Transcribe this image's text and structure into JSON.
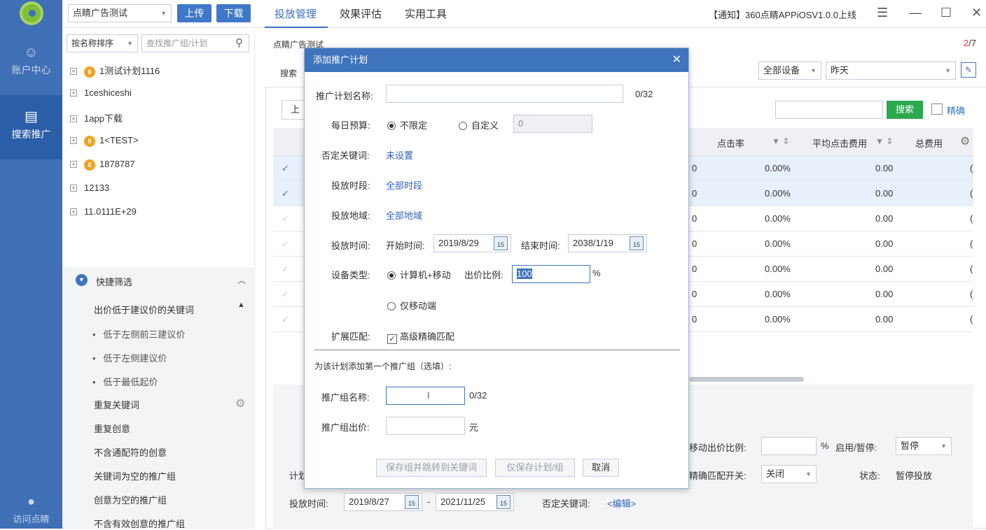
{
  "nav": {
    "items": [
      {
        "label": "账户中心",
        "icon": "account-icon"
      },
      {
        "label": "搜索推广",
        "icon": "search-promo-icon"
      }
    ],
    "bottom_label": "访问点睛"
  },
  "topbar": {
    "account_select": "点睛广告测试",
    "upload_label": "上传",
    "download_label": "下载",
    "tabs": [
      "投放管理",
      "效果评估",
      "实用工具"
    ],
    "notice": "【通知】360点睛APPiOSV1.0.0上线",
    "menu_icon": "menu-icon",
    "minimize_icon": "minimize-icon",
    "maximize_icon": "maximize-icon",
    "close_icon": "close-icon"
  },
  "sidebar": {
    "sort_select": "按名称排序",
    "search_placeholder": "查找推广组/计划",
    "plans": [
      {
        "name": "1测试计划1116",
        "paused": true
      },
      {
        "name": "1ceshiceshi",
        "paused": false
      },
      {
        "name": "1app下载",
        "paused": false
      },
      {
        "name": "1<TEST>",
        "paused": true
      },
      {
        "name": "1878787",
        "paused": true
      },
      {
        "name": "12133",
        "paused": false
      },
      {
        "name": "11.0111E+29",
        "paused": false
      }
    ],
    "quick_filter": {
      "title": "快捷筛选",
      "group": "出价低于建议价的关键词",
      "sub": [
        "低于左侧前三建议价",
        "低于左侧建议价",
        "低于最低起价"
      ],
      "items": [
        "重复关键词",
        "重复创意",
        "不含通配符的创意",
        "关键词为空的推广组",
        "创意为空的推广组",
        "不含有效创意的推广组"
      ]
    }
  },
  "main": {
    "breadcrumb": "点睛广告测试",
    "page": "2",
    "total": "/7",
    "search_label_partial": "搜索",
    "device_select": "全部设备",
    "date_select": "昨天",
    "upload_partial": "上",
    "search_button": "搜索",
    "exact_label": "精确",
    "columns": [
      "点击率",
      "平均点击费用",
      "总费用"
    ],
    "rows": [
      {
        "checked": true,
        "prev": "0",
        "ctr": "0.00%",
        "cpc": "0.00",
        "cost": "("
      },
      {
        "checked": true,
        "prev": "0",
        "ctr": "0.00%",
        "cpc": "0.00",
        "cost": "("
      },
      {
        "checked": false,
        "prev": "0",
        "ctr": "0.00%",
        "cpc": "0.00",
        "cost": "("
      },
      {
        "checked": false,
        "prev": "0",
        "ctr": "0.00%",
        "cpc": "0.00",
        "cost": "("
      },
      {
        "checked": false,
        "prev": "0",
        "ctr": "0.00%",
        "cpc": "0.00",
        "cost": "("
      },
      {
        "checked": false,
        "prev": "0",
        "ctr": "0.00%",
        "cpc": "0.00",
        "cost": "("
      },
      {
        "checked": false,
        "prev": "0",
        "ctr": "0.00%",
        "cpc": "0.00",
        "cost": "("
      }
    ],
    "detail": {
      "mobile_ratio_label": "移动出价比例:",
      "percent": "%",
      "enable_label": "启用/暂停:",
      "enable_value": "暂停",
      "exact_switch_label": "精确匹配开关:",
      "exact_switch_value": "关闭",
      "status_label": "状态:",
      "status_value": "暂停投放",
      "plan_partial": "计划",
      "time_label": "投放时间:",
      "start": "2019/8/27",
      "dash": "-",
      "end": "2021/11/25",
      "neg_label": "否定关键词:",
      "neg_link": "<编辑>"
    }
  },
  "dialog": {
    "title": "添加推广计划",
    "plan_name_label": "推广计划名称:",
    "plan_name_value": "",
    "plan_name_count": "0/32",
    "budget_label": "每日预算:",
    "budget_unlimited": "不限定",
    "budget_custom": "自定义",
    "budget_value": "0",
    "neg_label": "否定关键词:",
    "neg_value": "未设置",
    "period_label": "投放时段:",
    "period_value": "全部时段",
    "region_label": "投放地域:",
    "region_value": "全部地域",
    "time_label": "投放时间:",
    "start_label": "开始时间:",
    "start_value": "2019/8/29",
    "end_label": "结束时间:",
    "end_value": "2038/1/19",
    "device_label": "设备类型:",
    "device_pc_mobile": "计算机+移动",
    "bid_ratio_label": "出价比例:",
    "bid_ratio_value": "100",
    "percent": "%",
    "device_mobile_only": "仅移动端",
    "extend_label": "扩展匹配:",
    "extend_value": "高级精确匹配",
    "group_section": "为该计划添加第一个推广组（选填）:",
    "group_name_label": "推广组名称:",
    "group_name_count": "0/32",
    "group_bid_label": "推广组出价:",
    "group_bid_unit": "元",
    "btn_save_jump": "保存组并跳转到关键词",
    "btn_save_plan": "仅保存计划/组",
    "btn_cancel": "取消",
    "cal_day": "15"
  }
}
